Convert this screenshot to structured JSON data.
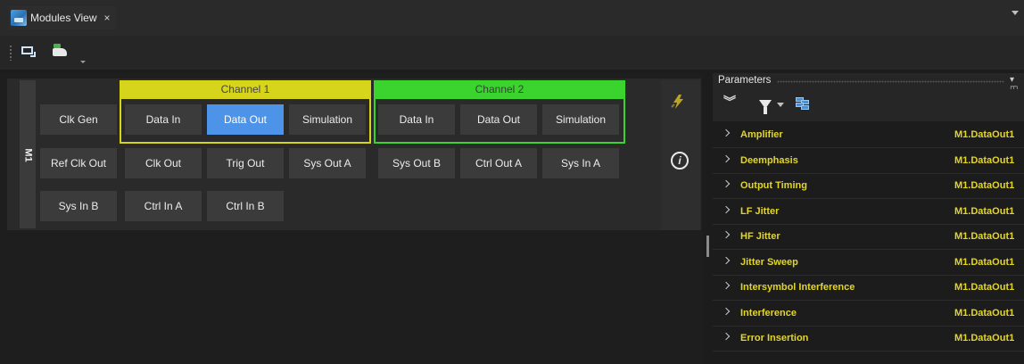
{
  "tab": {
    "title": "Modules View",
    "close": "×"
  },
  "module": {
    "label": "M1",
    "channels": [
      {
        "title": "Channel 1",
        "color": "#d7d51b",
        "buttons": [
          "Data In",
          "Data Out",
          "Simulation"
        ]
      },
      {
        "title": "Channel 2",
        "color": "#3bd42f",
        "buttons": [
          "Data In",
          "Data Out",
          "Simulation"
        ]
      }
    ],
    "active_button": "Data Out",
    "active_color": "#4d94e8",
    "buttons": {
      "clk_gen": "Clk Gen",
      "ref_clk_out": "Ref Clk Out",
      "clk_out": "Clk Out",
      "trig_out": "Trig Out",
      "sys_out_a": "Sys Out A",
      "sys_out_b": "Sys Out B",
      "ctrl_out_a": "Ctrl Out A",
      "sys_in_a": "Sys In A",
      "sys_in_b": "Sys In B",
      "ctrl_in_a": "Ctrl In A",
      "ctrl_in_b": "Ctrl In B"
    },
    "side_icons": [
      "plug-icon",
      "info-icon"
    ],
    "info_glyph": "i"
  },
  "parameters": {
    "title": "Parameters",
    "pin": "▾ ◫",
    "collapse_glyph": "»",
    "value_color": "#e3d629",
    "rows": [
      {
        "name": "Amplifier",
        "value": "M1.DataOut1"
      },
      {
        "name": "Deemphasis",
        "value": "M1.DataOut1"
      },
      {
        "name": "Output Timing",
        "value": "M1.DataOut1"
      },
      {
        "name": "LF Jitter",
        "value": "M1.DataOut1"
      },
      {
        "name": "HF Jitter",
        "value": "M1.DataOut1"
      },
      {
        "name": "Jitter Sweep",
        "value": "M1.DataOut1"
      },
      {
        "name": "Intersymbol Interference",
        "value": "M1.DataOut1"
      },
      {
        "name": "Interference",
        "value": "M1.DataOut1"
      },
      {
        "name": "Error Insertion",
        "value": "M1.DataOut1"
      }
    ]
  }
}
